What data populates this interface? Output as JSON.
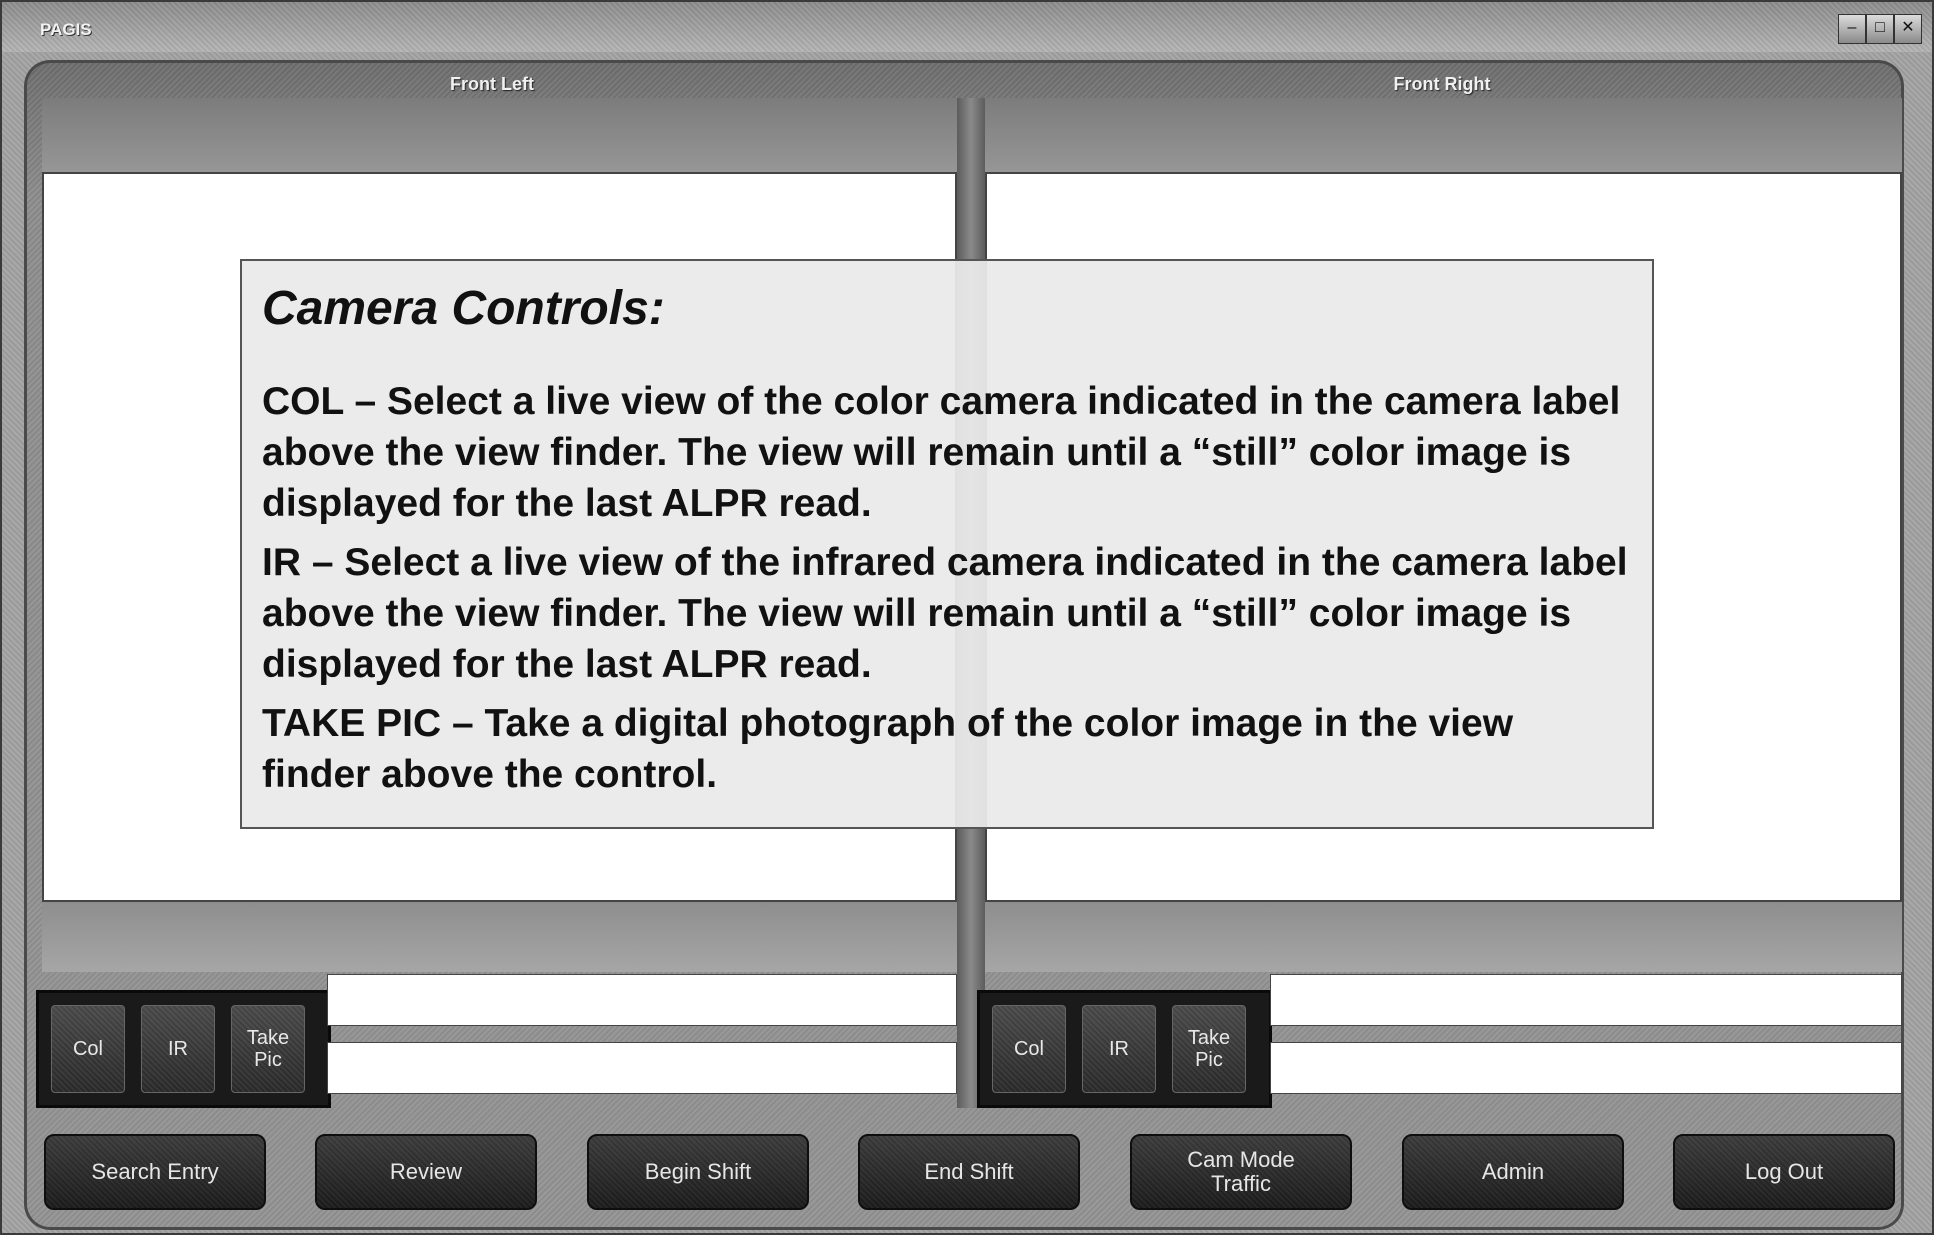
{
  "window": {
    "title": "PAGIS",
    "controls": {
      "minimize": "–",
      "maximize": "□",
      "close": "✕"
    }
  },
  "cameras": [
    {
      "label": "Front Left",
      "buttons": {
        "col": "Col",
        "ir": "IR",
        "take_pic": "Take Pic"
      }
    },
    {
      "label": "Front Right",
      "buttons": {
        "col": "Col",
        "ir": "IR",
        "take_pic": "Take Pic"
      }
    }
  ],
  "toolbar": {
    "search_entry": "Search Entry",
    "review": "Review",
    "begin_shift": "Begin Shift",
    "end_shift": "End Shift",
    "cam_mode_line1": "Cam Mode",
    "cam_mode_line2": "Traffic",
    "admin": "Admin",
    "log_out": "Log Out"
  },
  "callout": {
    "title": "Camera Controls:",
    "items": [
      "COL – Select a live view of the color camera indicated in the camera label above the view finder.  The view will remain until a “still” color image is displayed for the last ALPR read.",
      "IR – Select a live view of the infrared camera indicated in the camera label above the view finder. The view will remain until a “still” color image is displayed for the last ALPR read.",
      "TAKE PIC – Take a digital photograph of the color image in the view finder above the control."
    ]
  },
  "colors": {
    "chrome": "#a4a4a4",
    "button_dark": "#2a2a2a",
    "viewfinder": "#ffffff"
  }
}
